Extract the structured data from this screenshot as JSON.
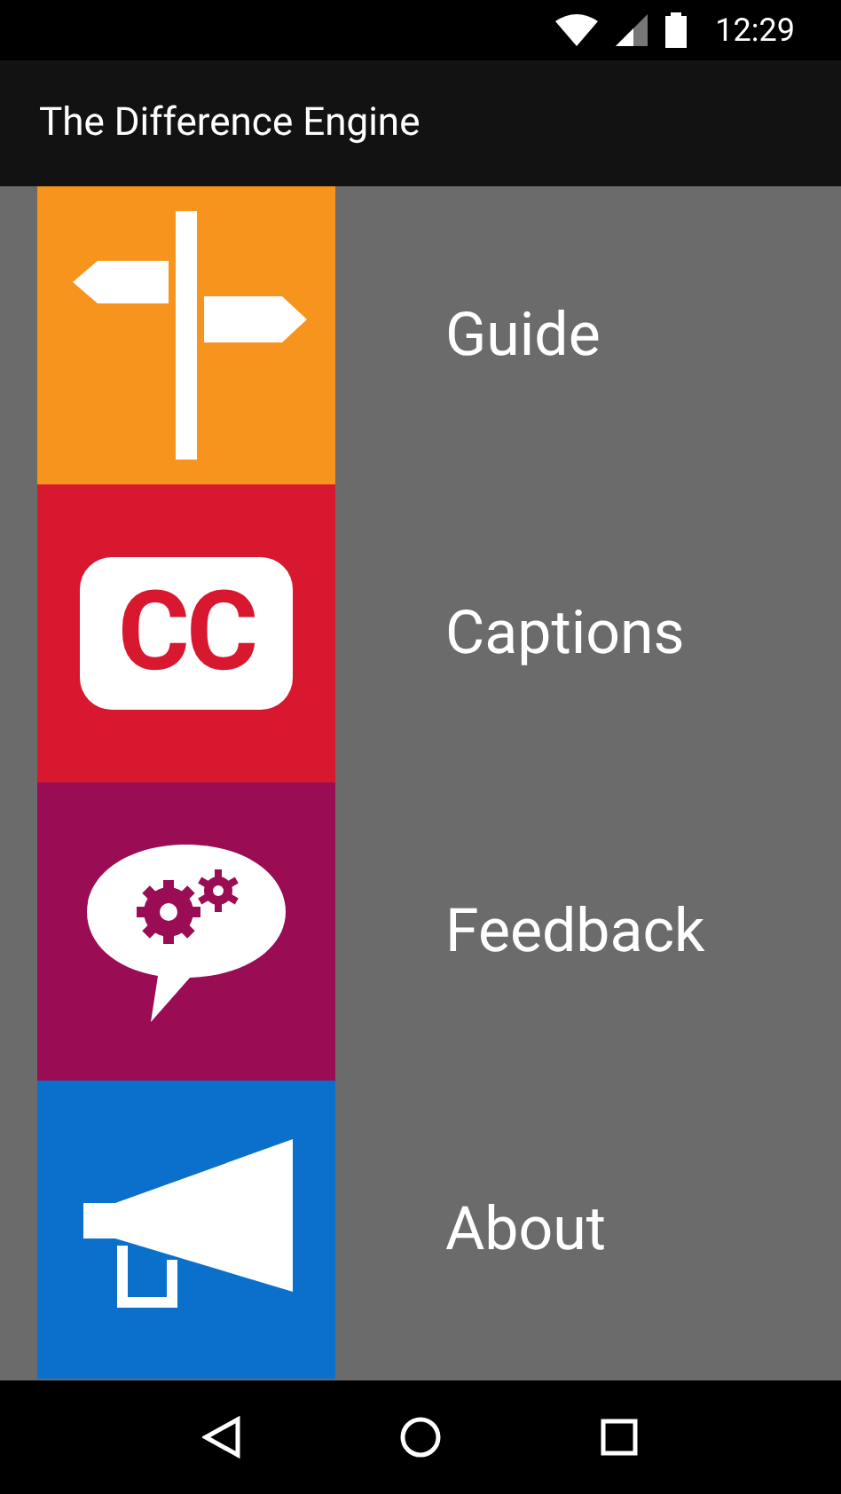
{
  "status_bar": {
    "time": "12:29"
  },
  "app_bar": {
    "title": "The Difference Engine"
  },
  "menu": [
    {
      "label": "Guide",
      "kind": "signpost",
      "color": "#f7941d"
    },
    {
      "label": "Captions",
      "kind": "captions",
      "color": "#d8182f",
      "icon_text": "CC"
    },
    {
      "label": "Feedback",
      "kind": "feedback",
      "color": "#9a0c54"
    },
    {
      "label": "About",
      "kind": "megaphone",
      "color": "#0b70cc"
    }
  ]
}
